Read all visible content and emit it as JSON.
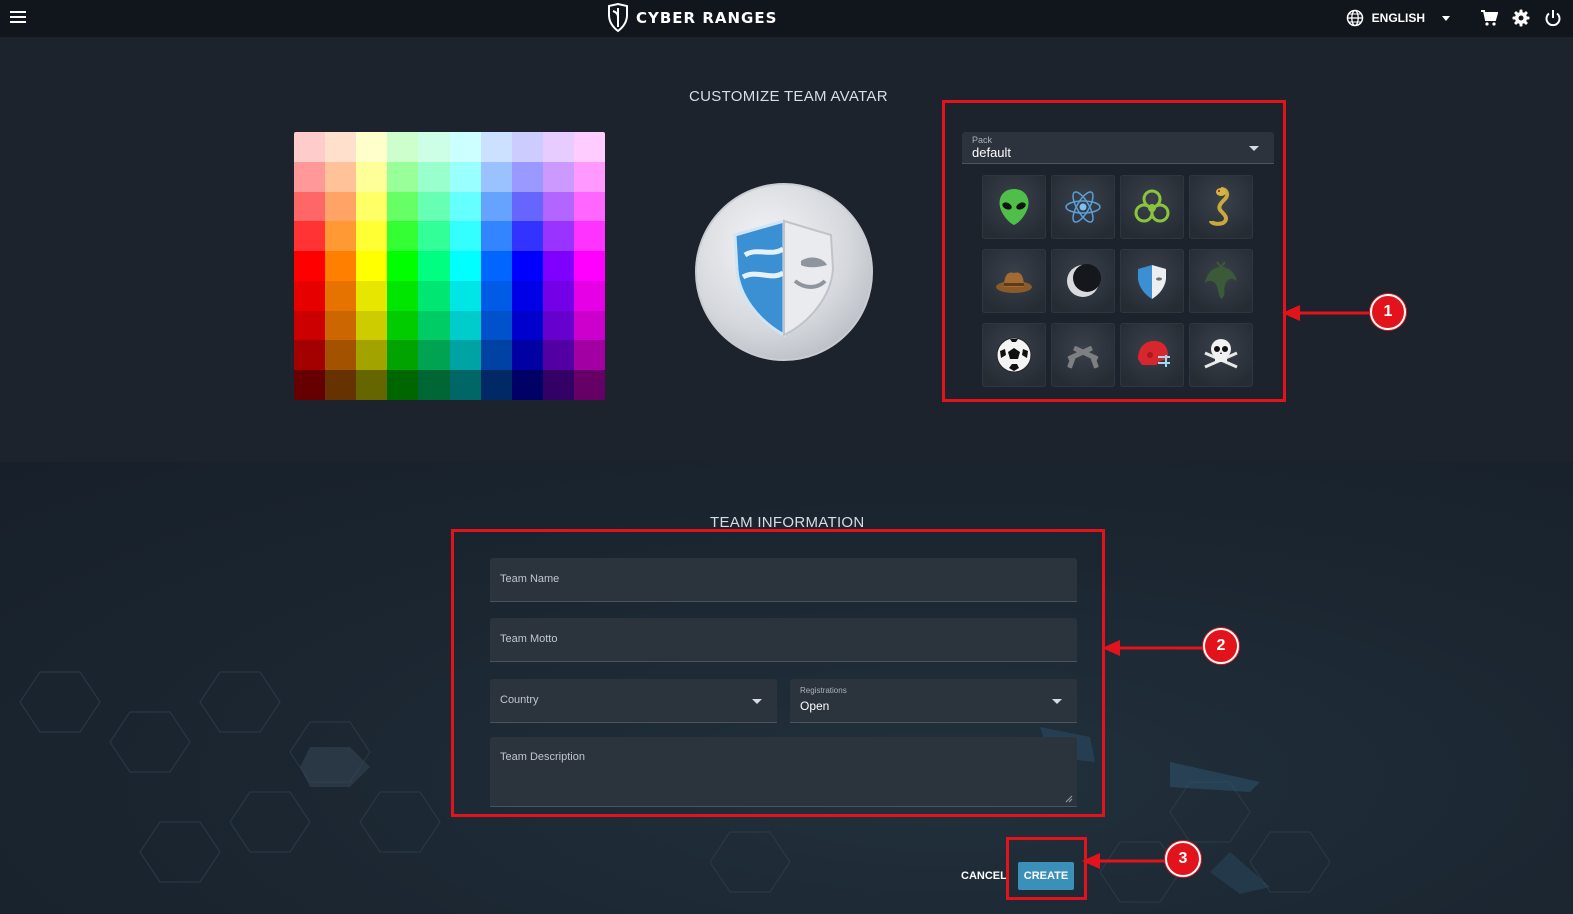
{
  "header": {
    "brand_name": "CYBER RANGES",
    "language": "ENGLISH"
  },
  "avatar": {
    "title": "CUSTOMIZE TEAM AVATAR",
    "pack_label": "Pack",
    "pack_value": "default",
    "icons": [
      "alien",
      "atom",
      "biohazard",
      "cobra",
      "cowboy-hat",
      "crescent-moon",
      "shield-mask",
      "dragon",
      "soccer-ball",
      "crossed-pistols",
      "football-helmet",
      "skull-crossbones"
    ],
    "palette_columns": [
      [
        "#ffcccc",
        "#ff9999",
        "#ff6666",
        "#ff3333",
        "#ff0000",
        "#e60000",
        "#cc0000",
        "#a30000",
        "#660000"
      ],
      [
        "#ffe0cc",
        "#ffc299",
        "#ffa366",
        "#ff9933",
        "#ff8000",
        "#e67300",
        "#cc6600",
        "#a35200",
        "#663300"
      ],
      [
        "#ffffcc",
        "#ffff99",
        "#ffff66",
        "#ffff33",
        "#ffff00",
        "#e6e600",
        "#cccc00",
        "#a3a300",
        "#666600"
      ],
      [
        "#ccffcc",
        "#99ff99",
        "#66ff66",
        "#33ff33",
        "#00ff00",
        "#00e600",
        "#00cc00",
        "#00a300",
        "#006600"
      ],
      [
        "#ccffe6",
        "#99ffcc",
        "#66ffb3",
        "#33ff99",
        "#00ff80",
        "#00e673",
        "#00cc66",
        "#00a352",
        "#006633"
      ],
      [
        "#ccffff",
        "#99ffff",
        "#66ffff",
        "#33ffff",
        "#00ffff",
        "#00e6e6",
        "#00cccc",
        "#00a3a3",
        "#006666"
      ],
      [
        "#cce0ff",
        "#99c2ff",
        "#66a3ff",
        "#3385ff",
        "#0066ff",
        "#005ce6",
        "#0052cc",
        "#0042a3",
        "#002966"
      ],
      [
        "#ccccff",
        "#9999ff",
        "#6666ff",
        "#3333ff",
        "#0000ff",
        "#0000e6",
        "#0000cc",
        "#0000a3",
        "#000066"
      ],
      [
        "#e6ccff",
        "#cc99ff",
        "#b366ff",
        "#9933ff",
        "#8000ff",
        "#7300e6",
        "#6600cc",
        "#5200a3",
        "#330066"
      ],
      [
        "#ffccff",
        "#ff99ff",
        "#ff66ff",
        "#ff33ff",
        "#ff00ff",
        "#e600e6",
        "#cc00cc",
        "#a300a3",
        "#660066"
      ]
    ]
  },
  "team_info": {
    "title": "TEAM INFORMATION",
    "team_name_placeholder": "Team Name",
    "team_motto_placeholder": "Team Motto",
    "country_placeholder": "Country",
    "registrations_label": "Registrations",
    "registrations_value": "Open",
    "description_placeholder": "Team Description",
    "cancel_label": "CANCEL",
    "create_label": "CREATE"
  },
  "annotations": {
    "step1": "1",
    "step2": "2",
    "step3": "3"
  },
  "colors": {
    "accent": "#3a90b8",
    "annotation_red": "#e3131b",
    "topbar": "#11161c"
  }
}
